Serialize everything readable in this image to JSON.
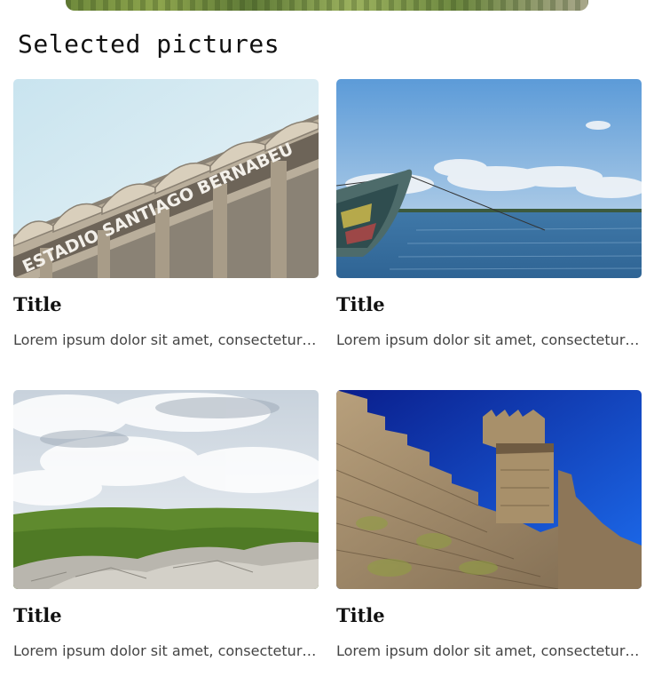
{
  "section": {
    "title": "Selected pictures"
  },
  "cards": [
    {
      "title": "Title",
      "description": "Lorem ipsum dolor sit amet, consectetur adipiscing elit",
      "stadium_sign": "ESTADIO SANTIAGO BERNABEU"
    },
    {
      "title": "Title",
      "description": "Lorem ipsum dolor sit amet, consectetur adipiscing elit"
    },
    {
      "title": "Title",
      "description": "Lorem ipsum dolor sit amet, consectetur adipiscing elit"
    },
    {
      "title": "Title",
      "description": "Lorem ipsum dolor sit amet, consectetur adipiscing elit"
    }
  ]
}
